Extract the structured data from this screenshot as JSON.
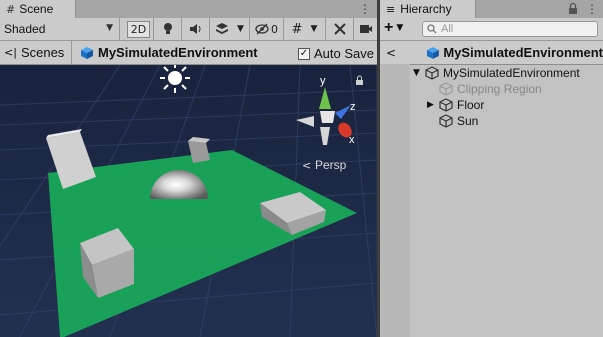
{
  "scene": {
    "tab_title": "Scene",
    "shading_mode": "Shaded",
    "btn_2d": "2D",
    "hidden_count": "0",
    "scenes_label": "Scenes",
    "scene_name": "MySimulatedEnvironment",
    "autosave_label": "Auto Save",
    "autosave_checked": true,
    "gizmo": {
      "y": "y",
      "z": "z",
      "x": "x"
    },
    "persp_label": "Persp",
    "colors": {
      "floor": "#1aa85a",
      "sky": "#1d2741",
      "grid": "#2d3a58"
    }
  },
  "hierarchy": {
    "tab_title": "Hierarchy",
    "search_placeholder": "All",
    "scene_name": "MySimulatedEnvironment",
    "items": [
      {
        "label": "MySimulatedEnvironment",
        "expanded": true,
        "disabled": false
      },
      {
        "label": "Clipping Region",
        "disabled": true
      },
      {
        "label": "Floor",
        "collapsed": true,
        "disabled": false
      },
      {
        "label": "Sun",
        "disabled": false
      }
    ]
  }
}
